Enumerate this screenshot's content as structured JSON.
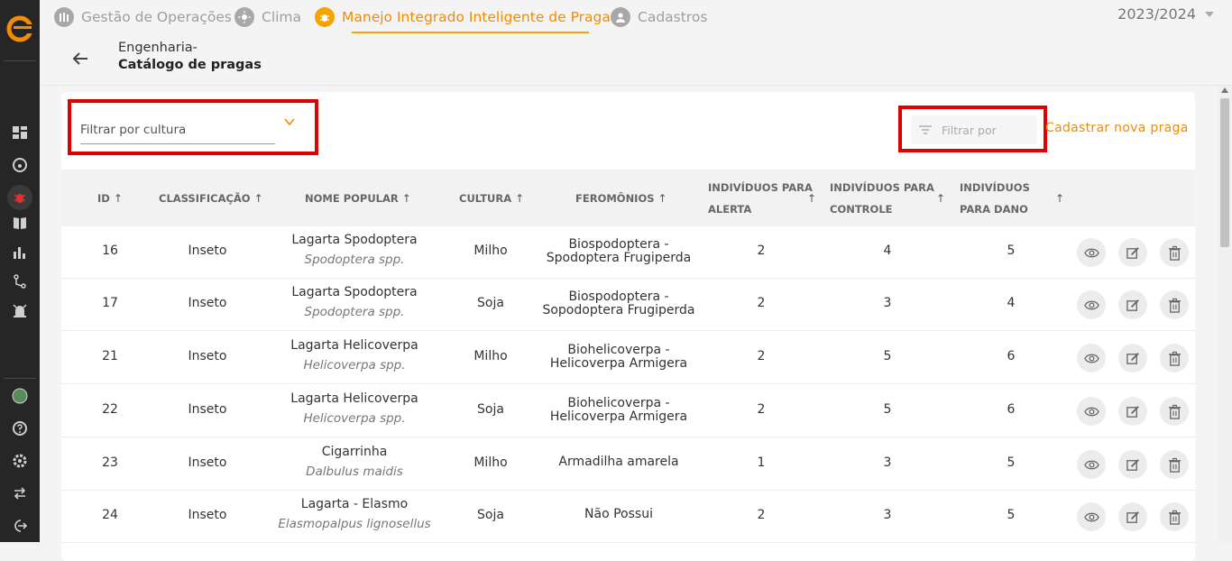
{
  "nav": {
    "tabs": [
      {
        "label": "Gestão de Operações",
        "icon": "operations-icon"
      },
      {
        "label": "Clima",
        "icon": "sun-icon"
      },
      {
        "label": "Manejo Integrado Inteligente de Pragas",
        "icon": "bug-icon",
        "active": true
      },
      {
        "label": "Cadastros",
        "icon": "user-icon"
      }
    ],
    "season": "2023/2024"
  },
  "header": {
    "breadcrumb_parent": "Engenharia-",
    "title": "Catálogo de pragas"
  },
  "toolbar": {
    "filter_culture_placeholder": "Filtrar por cultura",
    "filter_by_placeholder": "Filtrar por",
    "new_pest_label": "Cadastrar nova praga"
  },
  "table": {
    "headers": {
      "id": "ID",
      "classification": "CLASSIFICAÇÃO",
      "popular_name": "NOME POPULAR",
      "culture": "CULTURA",
      "pheromones": "FEROMÔNIOS",
      "alert_1": "INDIVÍDUOS PARA",
      "alert_2": "ALERTA",
      "control_1": "INDIVÍDUOS PARA",
      "control_2": "CONTROLE",
      "damage_1": "INDIVÍDUOS",
      "damage_2": "PARA DANO"
    },
    "rows": [
      {
        "id": "16",
        "classification": "Inseto",
        "popular": "Lagarta Spodoptera",
        "scientific": "Spodoptera spp.",
        "culture": "Milho",
        "fero1": "Biospodoptera -",
        "fero2": "Spodoptera Frugiperda",
        "alert": "2",
        "control": "4",
        "damage": "5"
      },
      {
        "id": "17",
        "classification": "Inseto",
        "popular": "Lagarta Spodoptera",
        "scientific": "Spodoptera spp.",
        "culture": "Soja",
        "fero1": "Biospodoptera -",
        "fero2": "Sopodoptera Frugiperda",
        "alert": "2",
        "control": "3",
        "damage": "4"
      },
      {
        "id": "21",
        "classification": "Inseto",
        "popular": "Lagarta Helicoverpa",
        "scientific": "Helicoverpa spp.",
        "culture": "Milho",
        "fero1": "Biohelicoverpa -",
        "fero2": "Helicoverpa Armigera",
        "alert": "2",
        "control": "5",
        "damage": "6"
      },
      {
        "id": "22",
        "classification": "Inseto",
        "popular": "Lagarta Helicoverpa",
        "scientific": "Helicoverpa spp.",
        "culture": "Soja",
        "fero1": "Biohelicoverpa -",
        "fero2": "Helicoverpa Armigera",
        "alert": "2",
        "control": "5",
        "damage": "6"
      },
      {
        "id": "23",
        "classification": "Inseto",
        "popular": "Cigarrinha",
        "scientific": "Dalbulus maidis",
        "culture": "Milho",
        "fero1": "Armadilha amarela",
        "fero2": "",
        "alert": "1",
        "control": "3",
        "damage": "5"
      },
      {
        "id": "24",
        "classification": "Inseto",
        "popular": "Lagarta - Elasmo",
        "scientific": "Elasmopalpus lignosellus",
        "culture": "Soja",
        "fero1": "Não Possui",
        "fero2": "",
        "alert": "2",
        "control": "3",
        "damage": "5"
      }
    ]
  },
  "colors": {
    "accent": "#f28c00",
    "sidebar": "#262626",
    "highlight_box": "#e00000"
  }
}
